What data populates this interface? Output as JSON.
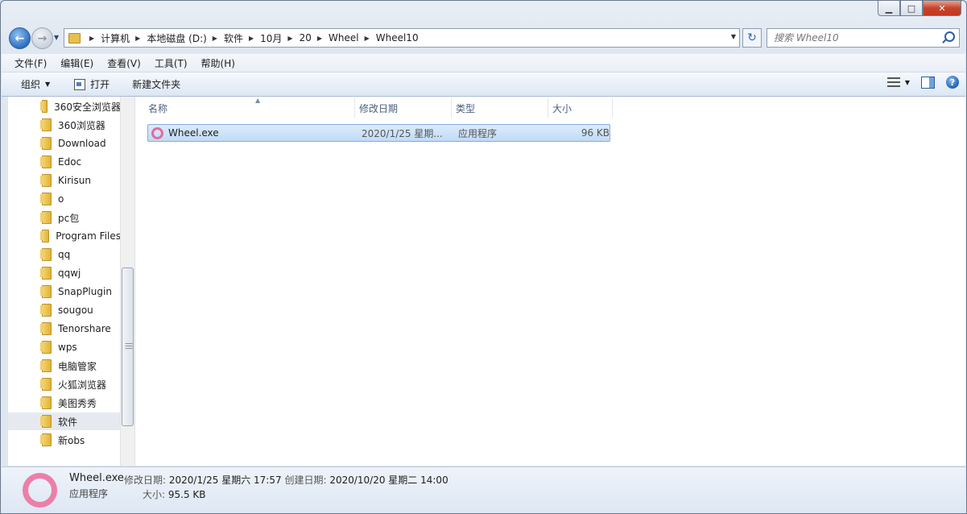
{
  "window": {
    "minimize_glyph": "▁",
    "maximize_glyph": "□",
    "close_glyph": "✕"
  },
  "nav": {
    "back_glyph": "←",
    "forward_glyph": "→",
    "refresh_glyph": "↻",
    "breadcrumb": [
      "计算机",
      "本地磁盘 (D:)",
      "软件",
      "10月",
      "20",
      "Wheel",
      "Wheel10"
    ],
    "search_placeholder": "搜索 Wheel10"
  },
  "menu": [
    "文件(F)",
    "编辑(E)",
    "查看(V)",
    "工具(T)",
    "帮助(H)"
  ],
  "toolbar": {
    "organize": "组织",
    "open": "打开",
    "new_folder": "新建文件夹",
    "help_glyph": "?"
  },
  "sidebar": {
    "items": [
      "360安全浏览器",
      "360浏览器",
      "Download",
      "Edoc",
      "Kirisun",
      "o",
      "pc包",
      "Program Files",
      "qq",
      "qqwj",
      "SnapPlugin",
      "sougou",
      "Tenorshare",
      "wps",
      "电脑管家",
      "火狐浏览器",
      "美图秀秀",
      "软件",
      "新obs"
    ],
    "selected": "软件"
  },
  "columns": [
    "名称",
    "修改日期",
    "类型",
    "大小"
  ],
  "files": [
    {
      "name": "Wheel.exe",
      "modified": "2020/1/25 星期...",
      "type": "应用程序",
      "size": "96 KB"
    }
  ],
  "details": {
    "name": "Wheel.exe",
    "type": "应用程序",
    "modified_label": "修改日期:",
    "modified_value": "2020/1/25 星期六 17:57",
    "created_label": "创建日期:",
    "created_value": "2020/10/20 星期二 14:00",
    "size_label": "大小:",
    "size_value": "95.5 KB"
  },
  "colors": {
    "accent_pink": "#e46b9b",
    "selection_blue": "#c1dbf7"
  }
}
